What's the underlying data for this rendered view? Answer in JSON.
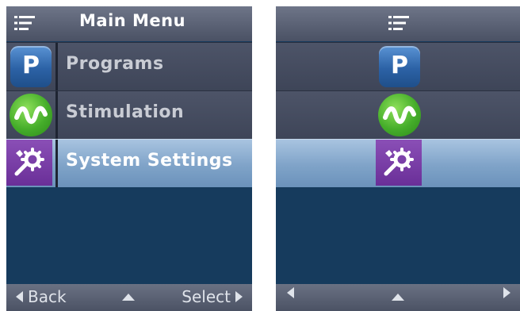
{
  "left_screen": {
    "header": {
      "title": "Main Menu",
      "icon": "list-menu-icon"
    },
    "items": [
      {
        "label": "Programs",
        "icon": "programs-p-icon",
        "selected": false
      },
      {
        "label": "Stimulation",
        "icon": "stimulation-wave-icon",
        "selected": false
      },
      {
        "label": "System Settings",
        "icon": "settings-tools-icon",
        "selected": true
      }
    ],
    "footer": {
      "back_label": "Back",
      "select_label": "Select"
    }
  },
  "right_screen": {
    "header": {
      "icon": "list-menu-icon"
    },
    "items": [
      {
        "icon": "programs-p-icon",
        "selected": false
      },
      {
        "icon": "stimulation-wave-icon",
        "selected": false
      },
      {
        "icon": "settings-tools-icon",
        "selected": true
      }
    ]
  },
  "icon_text": {
    "programs": "P"
  },
  "colors": {
    "background": "#163b5d",
    "header": "#5a6174",
    "selected_row": "#7fa3c8",
    "programs_icon": "#2c62a6",
    "stimulation_icon": "#45ad2a",
    "settings_icon": "#6a2f98"
  }
}
